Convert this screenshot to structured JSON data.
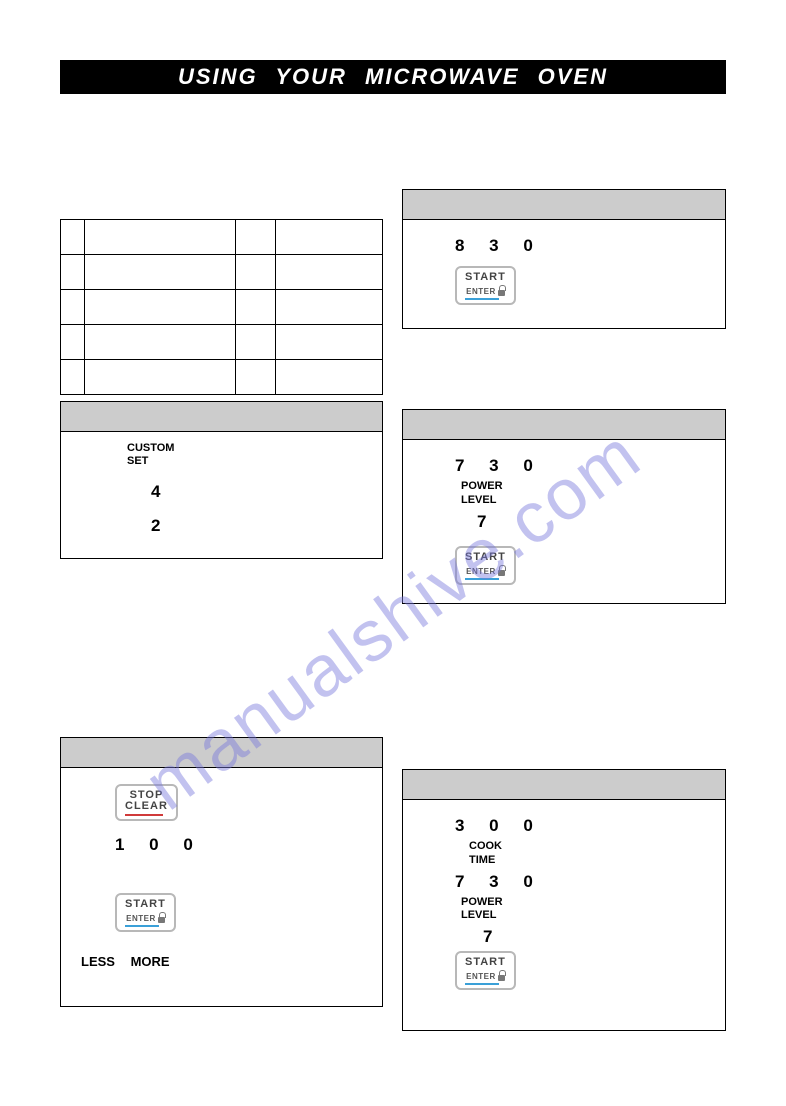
{
  "title": "USING  YOUR  MICROWAVE  OVEN",
  "watermark": "manualshive.com",
  "buttons": {
    "start_top": "START",
    "start_bot": "ENTER",
    "stop_top": "STOP",
    "stop_bot": "CLEAR"
  },
  "panel_830": {
    "digits": "8 3 0"
  },
  "panel_custom": {
    "label_line1": "CUSTOM",
    "label_line2": "SET",
    "num1": "4",
    "num2": "2"
  },
  "panel_730": {
    "digits": "7 3 0",
    "sub1": "POWER",
    "sub2": "LEVEL",
    "plnum": "7"
  },
  "panel_stop": {
    "digits": "1 0 0",
    "lessmore": "LESS    MORE"
  },
  "panel_cook": {
    "d1": "3  0  0",
    "sub1a": "COOK",
    "sub1b": "TIME",
    "d2": "7  3  0",
    "sub2a": "POWER",
    "sub2b": "LEVEL",
    "plnum": "7"
  }
}
